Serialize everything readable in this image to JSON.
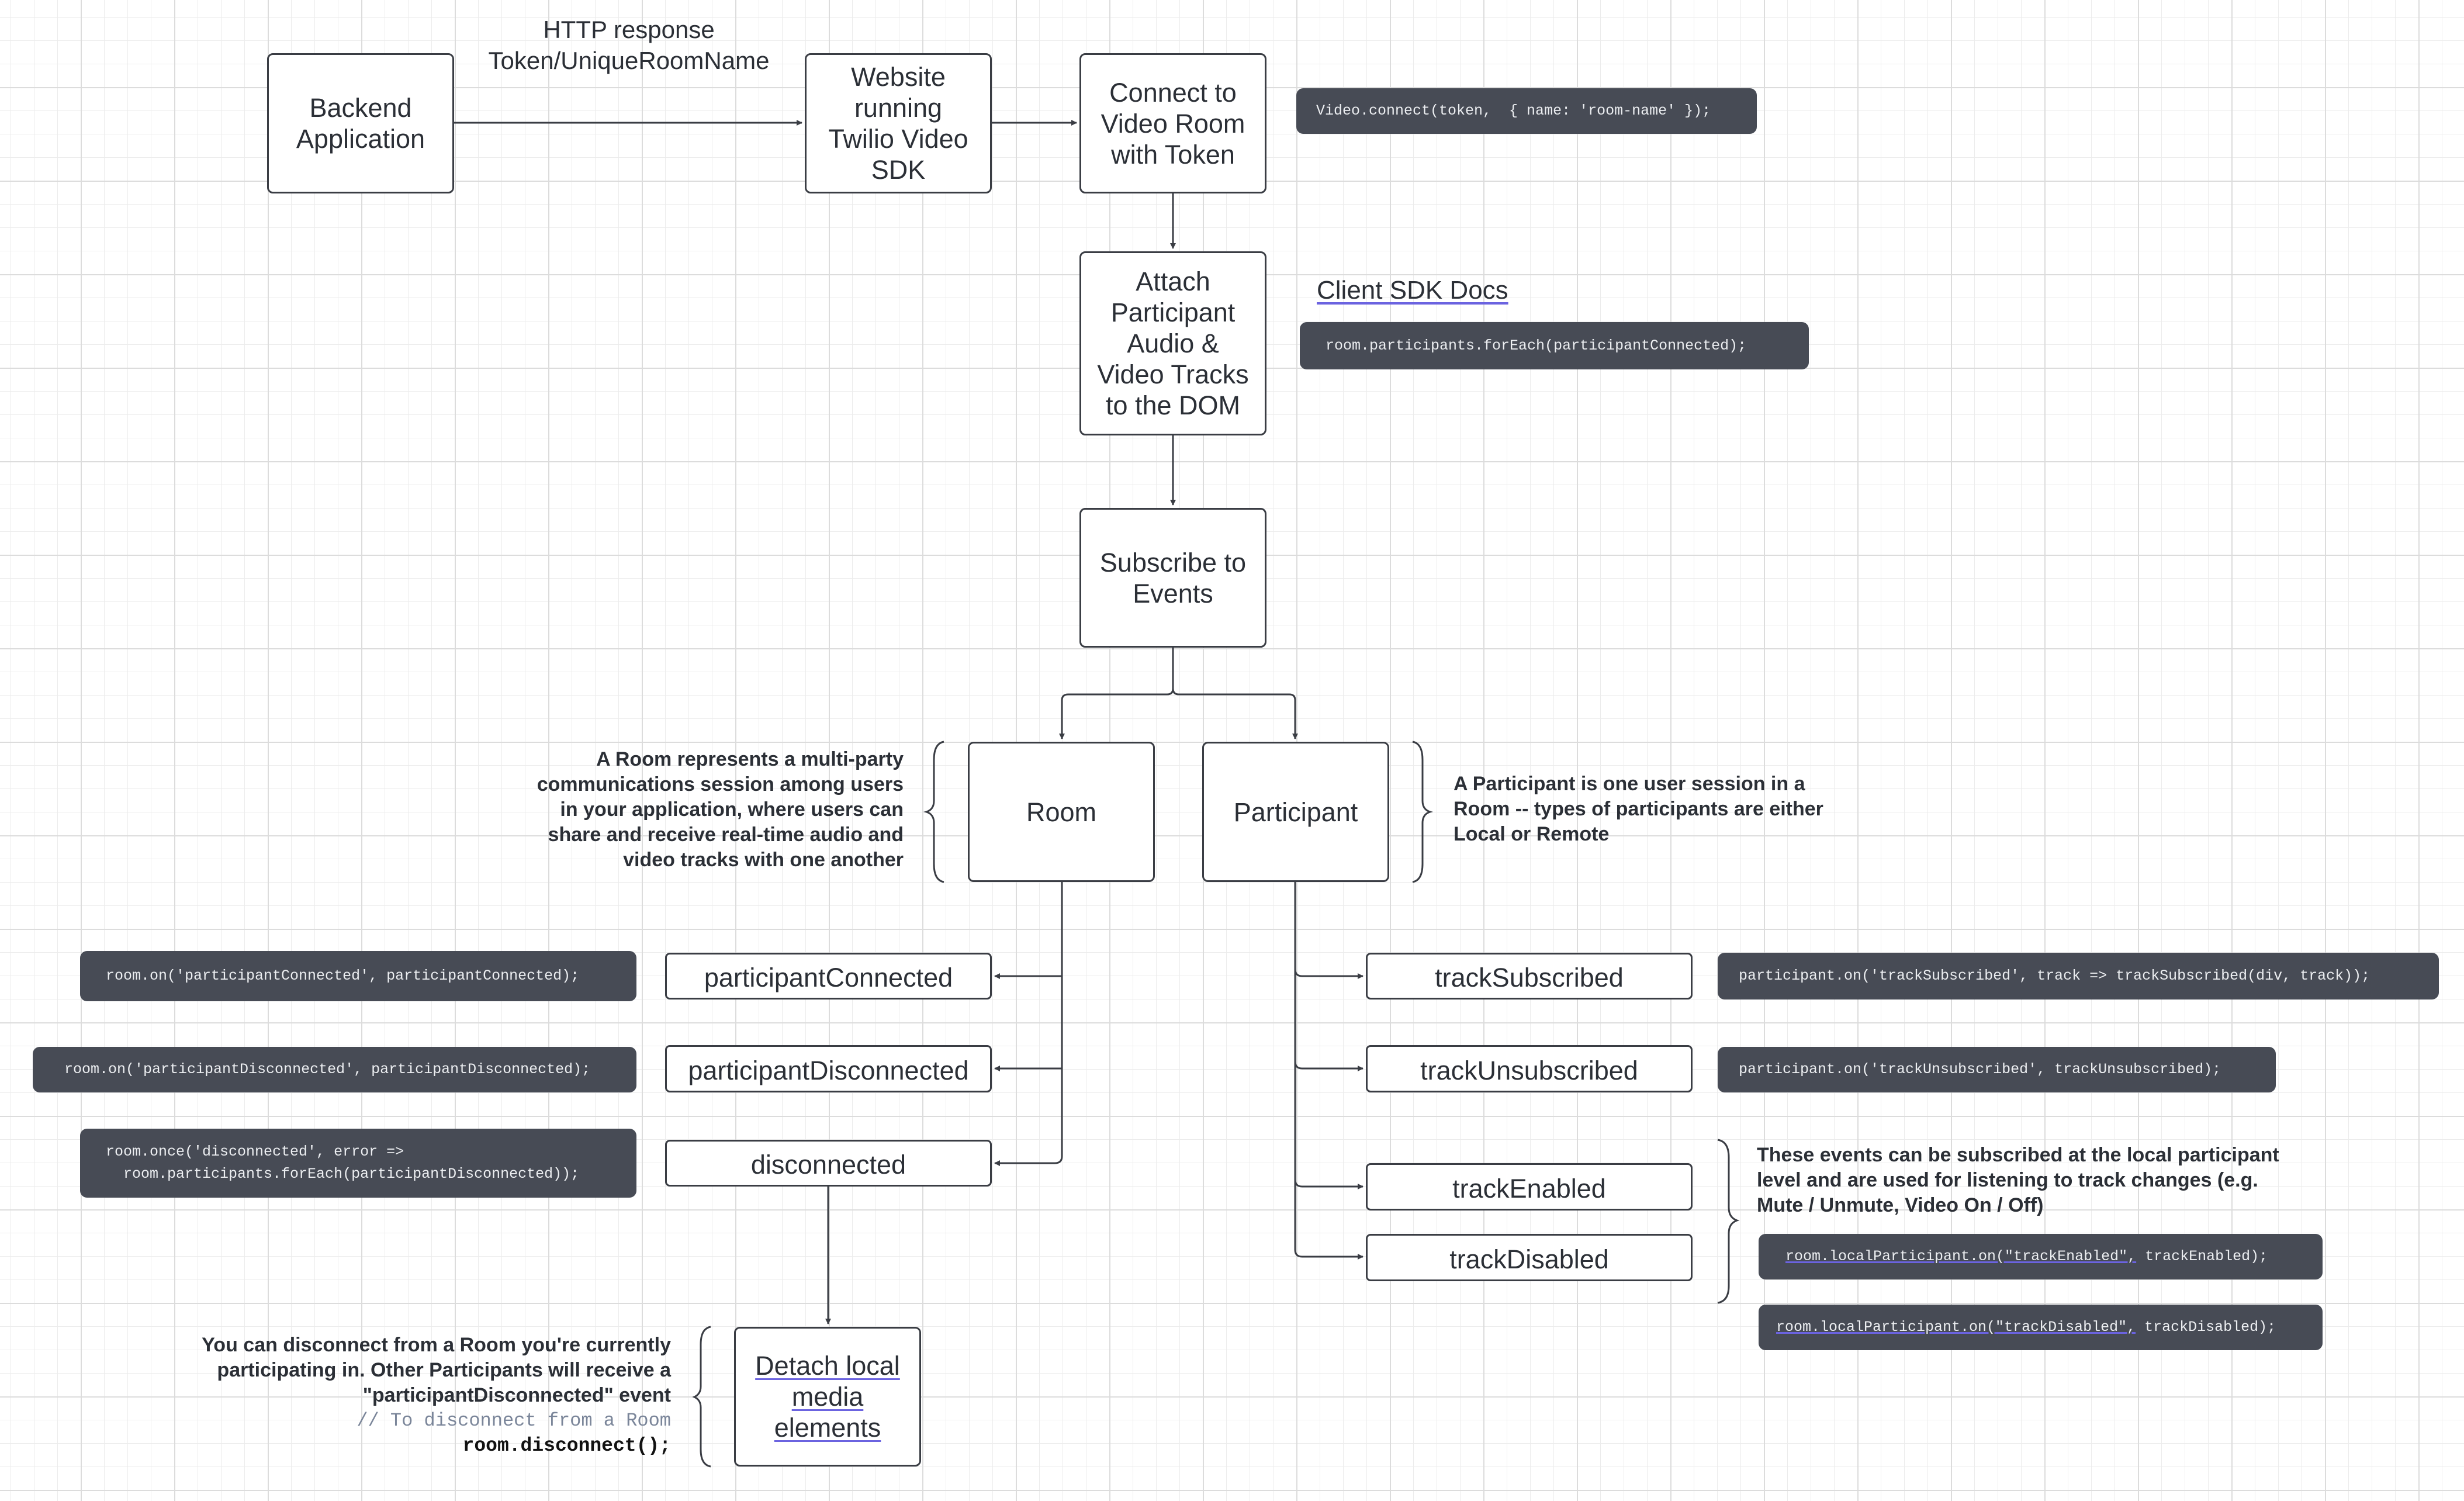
{
  "http_label": {
    "line1": "HTTP response",
    "line2": "Token/UniqueRoomName"
  },
  "nodes": {
    "backend": "Backend Application",
    "website": "Website running Twilio Video SDK",
    "connect": "Connect to Video Room with Token",
    "attach": "Attach Participant Audio & Video Tracks to the DOM",
    "subscribe": "Subscribe to Events",
    "room": "Room",
    "participant": "Participant",
    "detach": "Detach local media elements"
  },
  "room_events": [
    "participantConnected",
    "participantDisconnected",
    "disconnected"
  ],
  "participant_events": [
    "trackSubscribed",
    "trackUnsubscribed",
    "trackEnabled",
    "trackDisabled"
  ],
  "docs_link": "Client SDK Docs",
  "code": {
    "connect": "Video.connect(token,  { name: 'room-name' });",
    "for_each": "room.participants.forEach(participantConnected);",
    "participant_connected": "room.on('participantConnected', participantConnected);",
    "participant_disconnected": "room.on('participantDisconnected', participantDisconnected);",
    "disconnected_line1": "room.once('disconnected', error =>",
    "disconnected_line2": "  room.participants.forEach(participantDisconnected));",
    "track_subscribed": "participant.on('trackSubscribed', track => trackSubscribed(div, track));",
    "track_unsubscribed": "participant.on('trackUnsubscribed', trackUnsubscribed);",
    "track_enabled_link": "room.localParticipant.on(\"trackEnabled\",",
    "track_enabled_rest": " trackEnabled);",
    "track_disabled_link": "room.localParticipant.on(\"trackDisabled\",",
    "track_disabled_rest": " trackDisabled);"
  },
  "descriptions": {
    "room": [
      "A Room represents a multi-party",
      "communications session among users",
      "in your application, where users can",
      "share and receive real-time audio and",
      "video tracks with one another"
    ],
    "participant": [
      "A Participant is one user session in a",
      "Room -- types of participants are either",
      "Local or Remote"
    ],
    "local_events": [
      "These events can be subscribed at the local participant",
      "level and are used for listening to track changes (e.g.",
      "Mute / Unmute, Video On / Off)"
    ],
    "disconnect": [
      "You can disconnect from a Room you're currently",
      "participating in. Other Participants will receive a",
      "\"participantDisconnected\" event"
    ],
    "disconnect_comment": "// To disconnect from a Room",
    "disconnect_code": "room.disconnect();"
  },
  "colors": {
    "code_bg": "#474b55",
    "link_underline": "#6b63e0",
    "stroke": "#3a3d44"
  }
}
